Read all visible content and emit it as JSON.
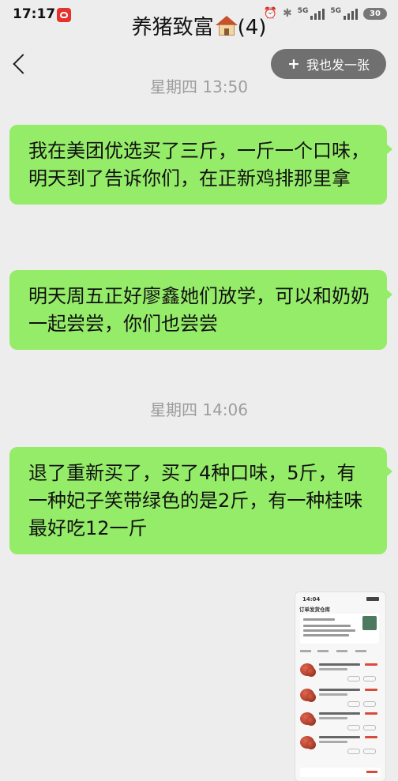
{
  "status_bar": {
    "time": "17:17",
    "network_1": "5G",
    "network_2": "5G",
    "battery": "30"
  },
  "header": {
    "title": "养猪致富",
    "member_count": "(4)",
    "share_button_label": "我也发一张"
  },
  "messages": [
    {
      "timestamp": "星期四 13:50"
    },
    {
      "text": "我在美团优选买了三斤，一斤一个口味，明天到了告诉你们，在正新鸡排那里拿"
    },
    {
      "text": "明天周五正好廖鑫她们放学，可以和奶奶一起尝尝，你们也尝尝"
    },
    {
      "timestamp": "星期四 14:06"
    },
    {
      "text": "退了重新买了，买了4种口味，5斤，有一种妃子笑带绿色的是2斤，有一种桂味最好吃12一斤"
    }
  ],
  "image_message": {
    "time": "14:04",
    "title": "订单发货仓库"
  }
}
